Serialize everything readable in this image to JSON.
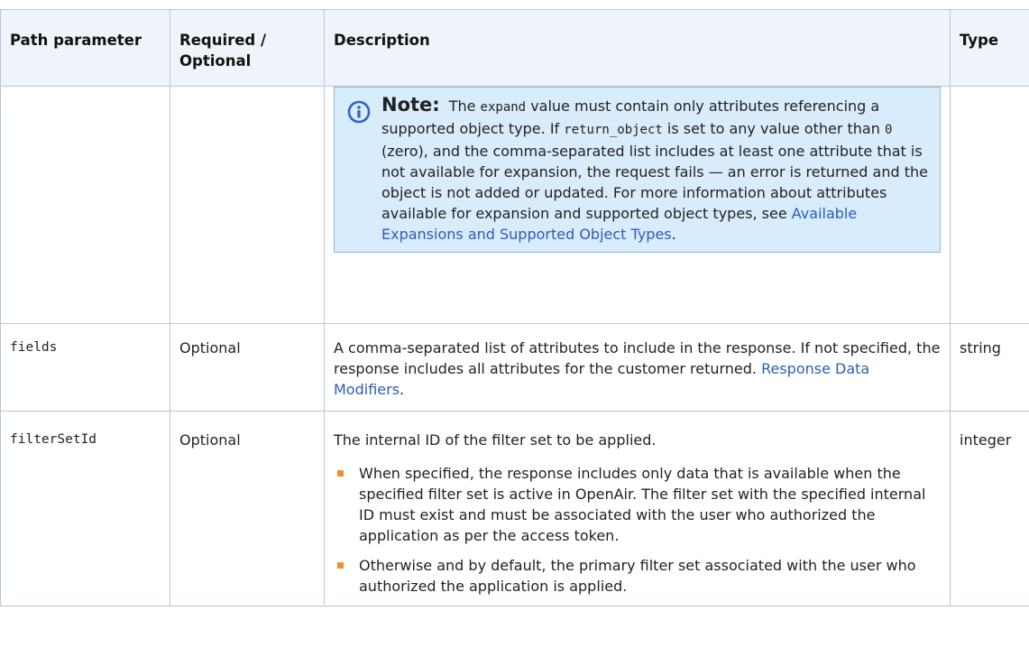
{
  "headers": {
    "path_parameter": "Path parameter",
    "required_optional": "Required / Optional",
    "description": "Description",
    "type": "Type"
  },
  "note": {
    "title": "Note:",
    "icon": "info-icon",
    "parts": [
      "The ",
      "expand",
      " value must contain only attributes referencing a supported object type. If ",
      "return_object",
      " is set to any value other than ",
      "0",
      " (zero), and the comma-separated list includes at least one attribute that is not available for expansion, the request fails — an error is returned and the object is not added or updated. For more information about attributes available for expansion and supported object types, see "
    ],
    "link": "Available Expansions and Supported Object Types",
    "end": "."
  },
  "rows": [
    {
      "name": "fields",
      "required": "Optional",
      "description": "A comma-separated list of attributes to include in the response. If not specified, the response includes all attributes for the customer returned. ",
      "link": "Response Data Modifiers",
      "link_end": ".",
      "type": "string"
    },
    {
      "name": "filterSetId",
      "required": "Optional",
      "description": "The internal ID of the filter set to be applied.",
      "bullets": [
        "When specified, the response includes only data that is available when the specified filter set is active in OpenAir. The filter set with the specified internal ID must exist and must be associated with the user who authorized the application as per the access token.",
        "Otherwise and by default, the primary filter set associated with the user who authorized the application is applied."
      ],
      "type": "integer"
    }
  ],
  "colors": {
    "header_bg": "#eef4fa",
    "border": "#b9c7d4",
    "note_bg": "#d9ecfb",
    "note_border": "#8fb9dc",
    "link": "#2e5cb8",
    "bullet": "#f0902e",
    "info_icon": "#2f64c4"
  }
}
